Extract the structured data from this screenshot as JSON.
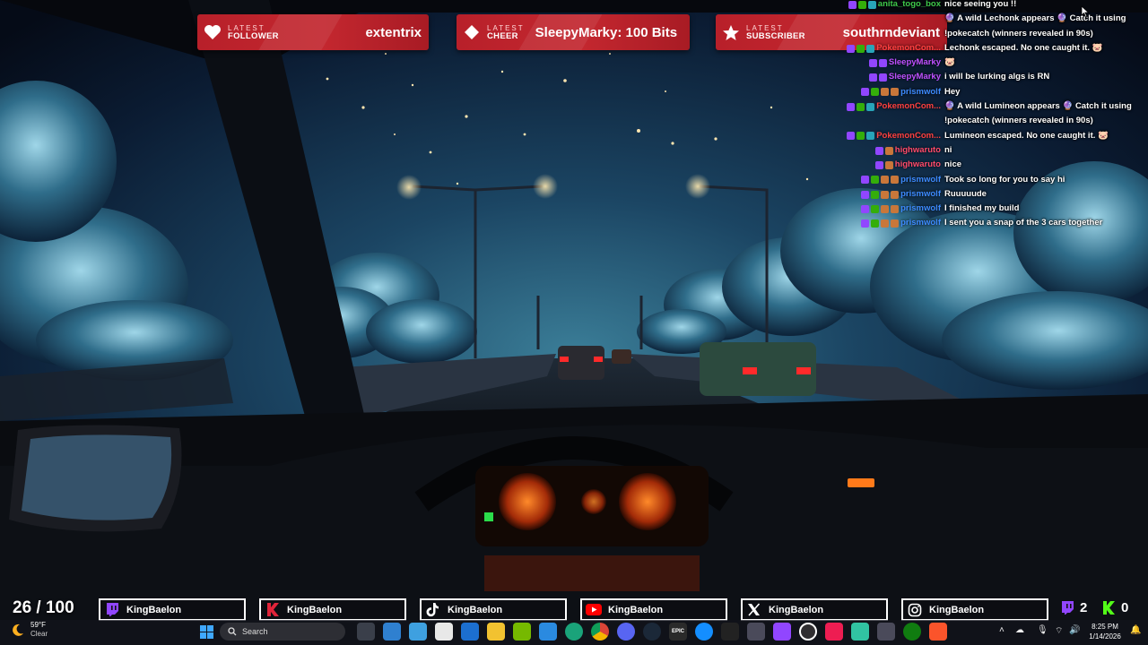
{
  "alerts": [
    {
      "kind": "follower",
      "line1": "LATEST",
      "line2": "FOLLOWER",
      "value": "extentrix",
      "icon": "heart-icon"
    },
    {
      "kind": "cheer",
      "line1": "LATEST",
      "line2": "CHEER",
      "value": "SleepyMarky: 100 Bits",
      "icon": "diamond-icon"
    },
    {
      "kind": "subscriber",
      "line1": "LATEST",
      "line2": "SUBSCRIBER",
      "value": "southrndeviant",
      "icon": "star-icon"
    }
  ],
  "chat": [
    {
      "user": "anita_togo_box",
      "user_color": "#3ec84a",
      "badges": [
        "tw",
        "mod",
        "sub"
      ],
      "lines": [
        "nice seeing you !!"
      ]
    },
    {
      "user": "",
      "user_color": "#ff4040",
      "badges": [],
      "lines": [
        "🔮 A wild Lechonk appears 🔮 Catch it using",
        "!pokecatch (winners revealed in 90s)"
      ]
    },
    {
      "user": "PokemonCom...",
      "user_color": "#ff4040",
      "badges": [
        "tw",
        "mod",
        "sub"
      ],
      "lines": [
        "Lechonk escaped. No one caught it. 🐷"
      ]
    },
    {
      "user": "SleepyMarky",
      "user_color": "#c050ff",
      "badges": [
        "tw",
        "tw"
      ],
      "lines": [
        "🐷"
      ]
    },
    {
      "user": "SleepyMarky",
      "user_color": "#c050ff",
      "badges": [
        "tw",
        "tw"
      ],
      "lines": [
        "i will be lurking algs is RN"
      ]
    },
    {
      "user": "prismwolf",
      "user_color": "#3d8bff",
      "badges": [
        "tw",
        "mod",
        "gift",
        "gift"
      ],
      "lines": [
        "Hey"
      ]
    },
    {
      "user": "PokemonCom...",
      "user_color": "#ff4040",
      "badges": [
        "tw",
        "mod",
        "sub"
      ],
      "lines": [
        "🔮 A wild Lumineon appears 🔮 Catch it using",
        "!pokecatch (winners revealed in 90s)"
      ]
    },
    {
      "user": "PokemonCom...",
      "user_color": "#ff4040",
      "badges": [
        "tw",
        "mod",
        "sub"
      ],
      "lines": [
        "Lumineon escaped. No one caught it. 🐷"
      ]
    },
    {
      "user": "highwaruto",
      "user_color": "#ff4a6a",
      "badges": [
        "tw",
        "gift"
      ],
      "lines": [
        "ni"
      ]
    },
    {
      "user": "highwaruto",
      "user_color": "#ff4a6a",
      "badges": [
        "tw",
        "gift"
      ],
      "lines": [
        "nice"
      ]
    },
    {
      "user": "prismwolf",
      "user_color": "#3d8bff",
      "badges": [
        "tw",
        "mod",
        "gift",
        "gift"
      ],
      "lines": [
        "Took so long for you to say hi"
      ]
    },
    {
      "user": "prismwolf",
      "user_color": "#3d8bff",
      "badges": [
        "tw",
        "mod",
        "gift",
        "gift"
      ],
      "lines": [
        "Ruuuuude"
      ]
    },
    {
      "user": "prismwolf",
      "user_color": "#3d8bff",
      "badges": [
        "tw",
        "mod",
        "gift",
        "gift"
      ],
      "lines": [
        "I finished my build"
      ]
    },
    {
      "user": "prismwolf",
      "user_color": "#3d8bff",
      "badges": [
        "tw",
        "mod",
        "gift",
        "gift"
      ],
      "lines": [
        "I sent you a snap of the 3 cars together"
      ]
    }
  ],
  "viewers": "26 / 100",
  "socials": [
    {
      "platform": "twitch",
      "icon": "twitch-icon",
      "handle": "KingBaelon",
      "color": "#9146ff"
    },
    {
      "platform": "kick",
      "icon": "kick-k-icon",
      "handle": "KingBaelon",
      "color": "#e0243a"
    },
    {
      "platform": "tiktok",
      "icon": "tiktok-icon",
      "handle": "KingBaelon",
      "color": "#ffffff"
    },
    {
      "platform": "youtube",
      "icon": "youtube-icon",
      "handle": "KingBaelon",
      "color": "#ff0000"
    },
    {
      "platform": "x",
      "icon": "x-icon",
      "handle": "KingBaelon",
      "color": "#ffffff"
    },
    {
      "platform": "instagram",
      "icon": "instagram-icon",
      "handle": "KingBaelon",
      "color": "#ffffff"
    }
  ],
  "stats": {
    "twitch_count": "2",
    "kick_count": "0"
  },
  "weather": {
    "temp": "59°F",
    "condition": "Clear"
  },
  "taskbar": {
    "search_placeholder": "Search"
  },
  "clock": {
    "time": "8:25 PM",
    "date": "1/14/2026"
  },
  "colors": {
    "alert_red": "#c3272f",
    "twitch_purple": "#9146ff",
    "kick_green": "#53fc18",
    "sky": "#0e2a44"
  }
}
